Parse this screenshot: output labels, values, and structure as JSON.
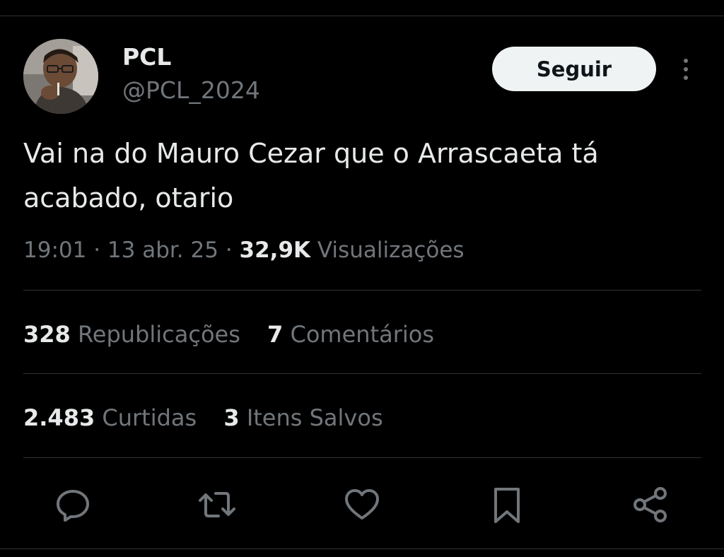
{
  "author": {
    "display_name": "PCL",
    "handle": "@PCL_2024",
    "avatar_icon": "profile-photo"
  },
  "follow_button": {
    "label": "Seguir"
  },
  "more_menu": {
    "icon": "more-vertical-icon"
  },
  "tweet": {
    "text": "Vai na do Mauro Cezar que o Arrascaeta tá acabado, otario"
  },
  "meta": {
    "time": "19:01",
    "separator": "·",
    "date": "13 abr. 25",
    "views_count": "32,9K",
    "views_label": "Visualizações"
  },
  "stats": {
    "reposts": {
      "count": "328",
      "label": "Republicações"
    },
    "comments": {
      "count": "7",
      "label": "Comentários"
    },
    "likes": {
      "count": "2.483",
      "label": "Curtidas"
    },
    "bookmarks": {
      "count": "3",
      "label": "Itens Salvos"
    }
  },
  "actions": [
    {
      "icon": "reply-icon"
    },
    {
      "icon": "repost-icon"
    },
    {
      "icon": "like-icon"
    },
    {
      "icon": "bookmark-icon"
    },
    {
      "icon": "share-icon"
    }
  ],
  "colors": {
    "background": "#000000",
    "text_primary": "#e7e9ea",
    "text_secondary": "#71767b",
    "divider": "#2f3336",
    "button_bg": "#eff3f4"
  }
}
